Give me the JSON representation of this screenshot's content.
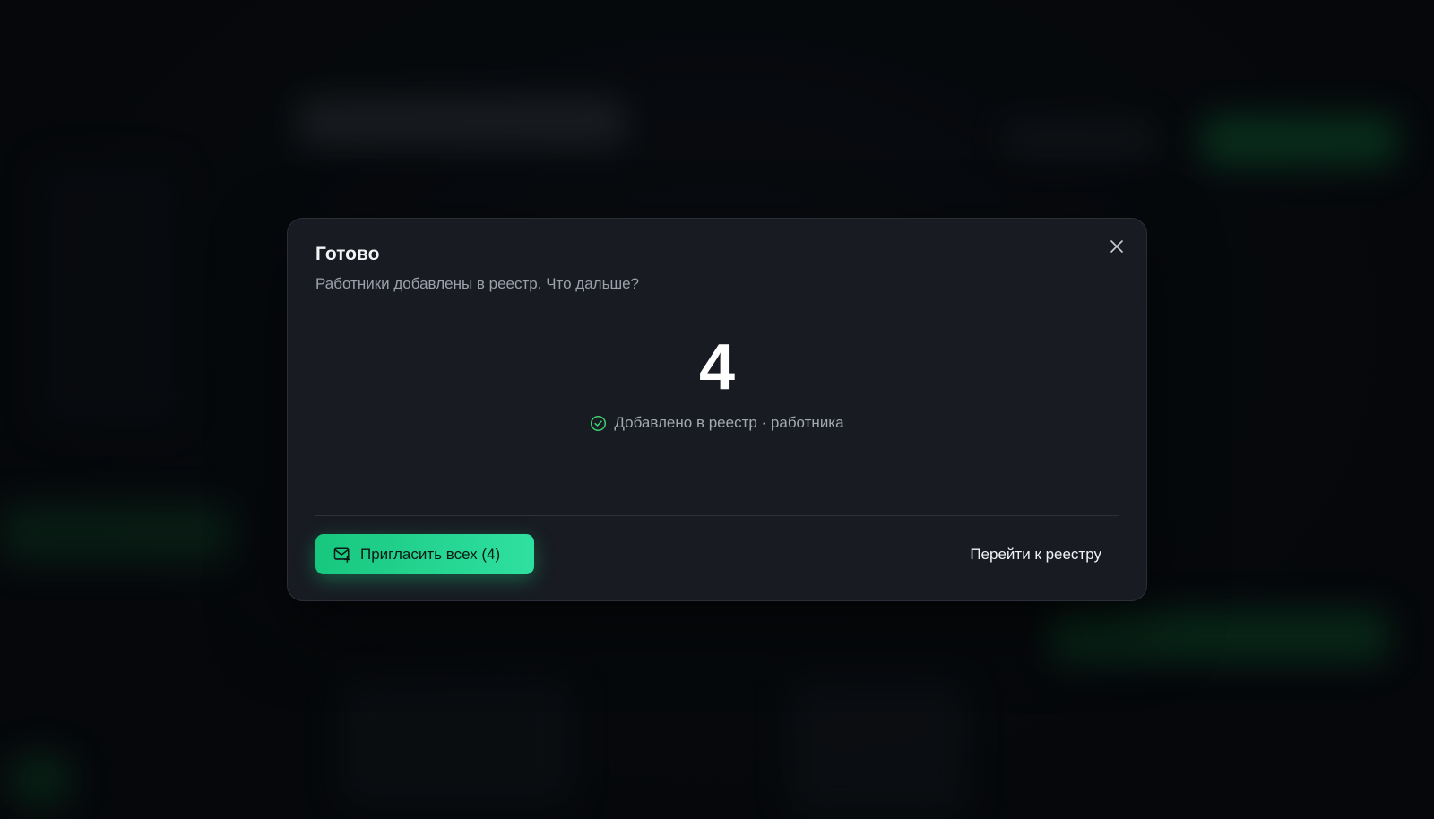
{
  "dialog": {
    "title": "Готово",
    "subtitle": "Работники добавлены в реестр. Что дальше?",
    "close_icon": "close-icon",
    "count": "4",
    "status_text": "Добавлено в реестр · работника",
    "status_icon": "check-circle-icon",
    "invite_button": {
      "label": "Пригласить всех (4)",
      "icon": "mail-plus-icon"
    },
    "goto_button": {
      "label": "Перейти к реестру"
    }
  },
  "colors": {
    "accent": "#1fd38c",
    "success": "#3ecf72",
    "modal_bg": "#181b22",
    "page_bg": "#07090c"
  }
}
